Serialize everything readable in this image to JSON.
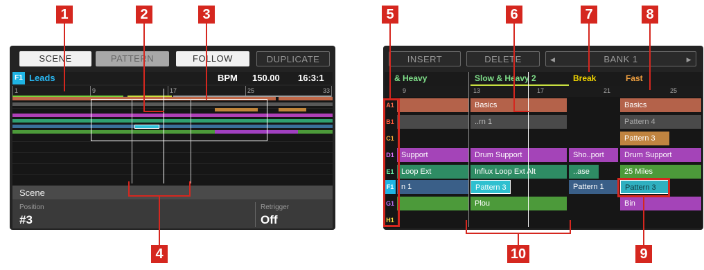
{
  "left": {
    "buttons": {
      "scene": "SCENE",
      "pattern": "PATTERN",
      "follow": "FOLLOW",
      "duplicate": "DUPLICATE"
    },
    "group_tag": "F1",
    "group_name": "Leads",
    "bpm_label": "BPM",
    "bpm_value": "150.00",
    "position": "16:3:1",
    "ruler": [
      "1",
      "9",
      "17",
      "25",
      "33"
    ],
    "scene_panel": {
      "title": "Scene",
      "position_label": "Position",
      "position_value": "#3",
      "retrigger_label": "Retrigger",
      "retrigger_value": "Off"
    }
  },
  "right": {
    "buttons": {
      "insert": "INSERT",
      "delete": "DELETE",
      "bank": "BANK 1",
      "prev": "◀",
      "next": "▶"
    },
    "scenes": [
      {
        "name": "& Heavy",
        "color": "#7fe08a"
      },
      {
        "name": "Slow & Heavy 2",
        "color": "#7fe08a"
      },
      {
        "name": "Break",
        "color": "#f0d400"
      },
      {
        "name": "Fast",
        "color": "#f0a040"
      }
    ],
    "ruler": [
      "9",
      "13",
      "17",
      "21",
      "25"
    ],
    "row_labels": [
      {
        "label": "A1",
        "color": "#ff6a4a"
      },
      {
        "label": "B1",
        "color": "#ff5a3a"
      },
      {
        "label": "C1",
        "color": "#ffae3a"
      },
      {
        "label": "D1",
        "color": "#e070ff"
      },
      {
        "label": "E1",
        "color": "#6affb0"
      },
      {
        "label": "F1",
        "color": "#ffffff"
      },
      {
        "label": "G1",
        "color": "#c070ff"
      },
      {
        "label": "H1",
        "color": "#ffe040"
      }
    ],
    "cells": {
      "r0": [
        "",
        "Basics",
        "",
        "Basics"
      ],
      "r1": [
        "",
        "..rn 1",
        "",
        "Pattern 4"
      ],
      "r2": [
        "",
        "",
        "",
        "Pattern 3"
      ],
      "r3": [
        "Support",
        "Drum Support",
        "Sho..port",
        "Drum Support"
      ],
      "r4": [
        "Loop Ext",
        "Influx Loop Ext Alt",
        "..ase",
        "25 Miles"
      ],
      "r5": [
        "n 1",
        "Pattern 3",
        "Pattern 1",
        "Pattern 3"
      ],
      "r6": [
        "",
        "Plou",
        "",
        "Bin"
      ],
      "r7": [
        "",
        "",
        "",
        ""
      ]
    }
  },
  "callouts": [
    "1",
    "2",
    "3",
    "4",
    "5",
    "6",
    "7",
    "8",
    "9",
    "10"
  ],
  "colors": {
    "callout": "#d5271f",
    "screen_bg": "#232323",
    "accent": "#1fb4e4"
  }
}
